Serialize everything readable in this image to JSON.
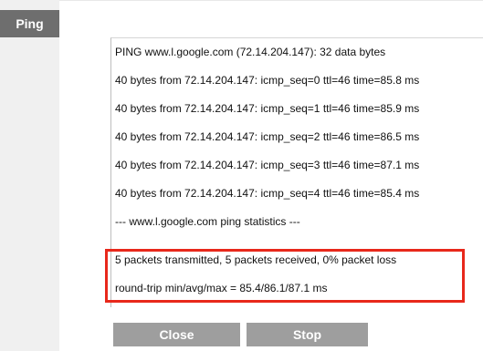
{
  "tab": {
    "label": "Ping"
  },
  "output": {
    "lines": [
      "PING www.l.google.com (72.14.204.147): 32 data bytes",
      "40 bytes from 72.14.204.147: icmp_seq=0 ttl=46 time=85.8 ms",
      "40 bytes from 72.14.204.147: icmp_seq=1 ttl=46 time=85.9 ms",
      "40 bytes from 72.14.204.147: icmp_seq=2 ttl=46 time=86.5 ms",
      "40 bytes from 72.14.204.147: icmp_seq=3 ttl=46 time=87.1 ms",
      "40 bytes from 72.14.204.147: icmp_seq=4 ttl=46 time=85.4 ms",
      "--- www.l.google.com ping statistics ---",
      "5 packets transmitted, 5 packets received, 0% packet loss",
      "round-trip min/avg/max = 85.4/86.1/87.1 ms"
    ]
  },
  "buttons": {
    "close": "Close",
    "stop": "Stop"
  },
  "colors": {
    "tab_bg": "#6e6e6e",
    "button_bg": "#9e9e9e",
    "highlight": "#e8281b"
  }
}
